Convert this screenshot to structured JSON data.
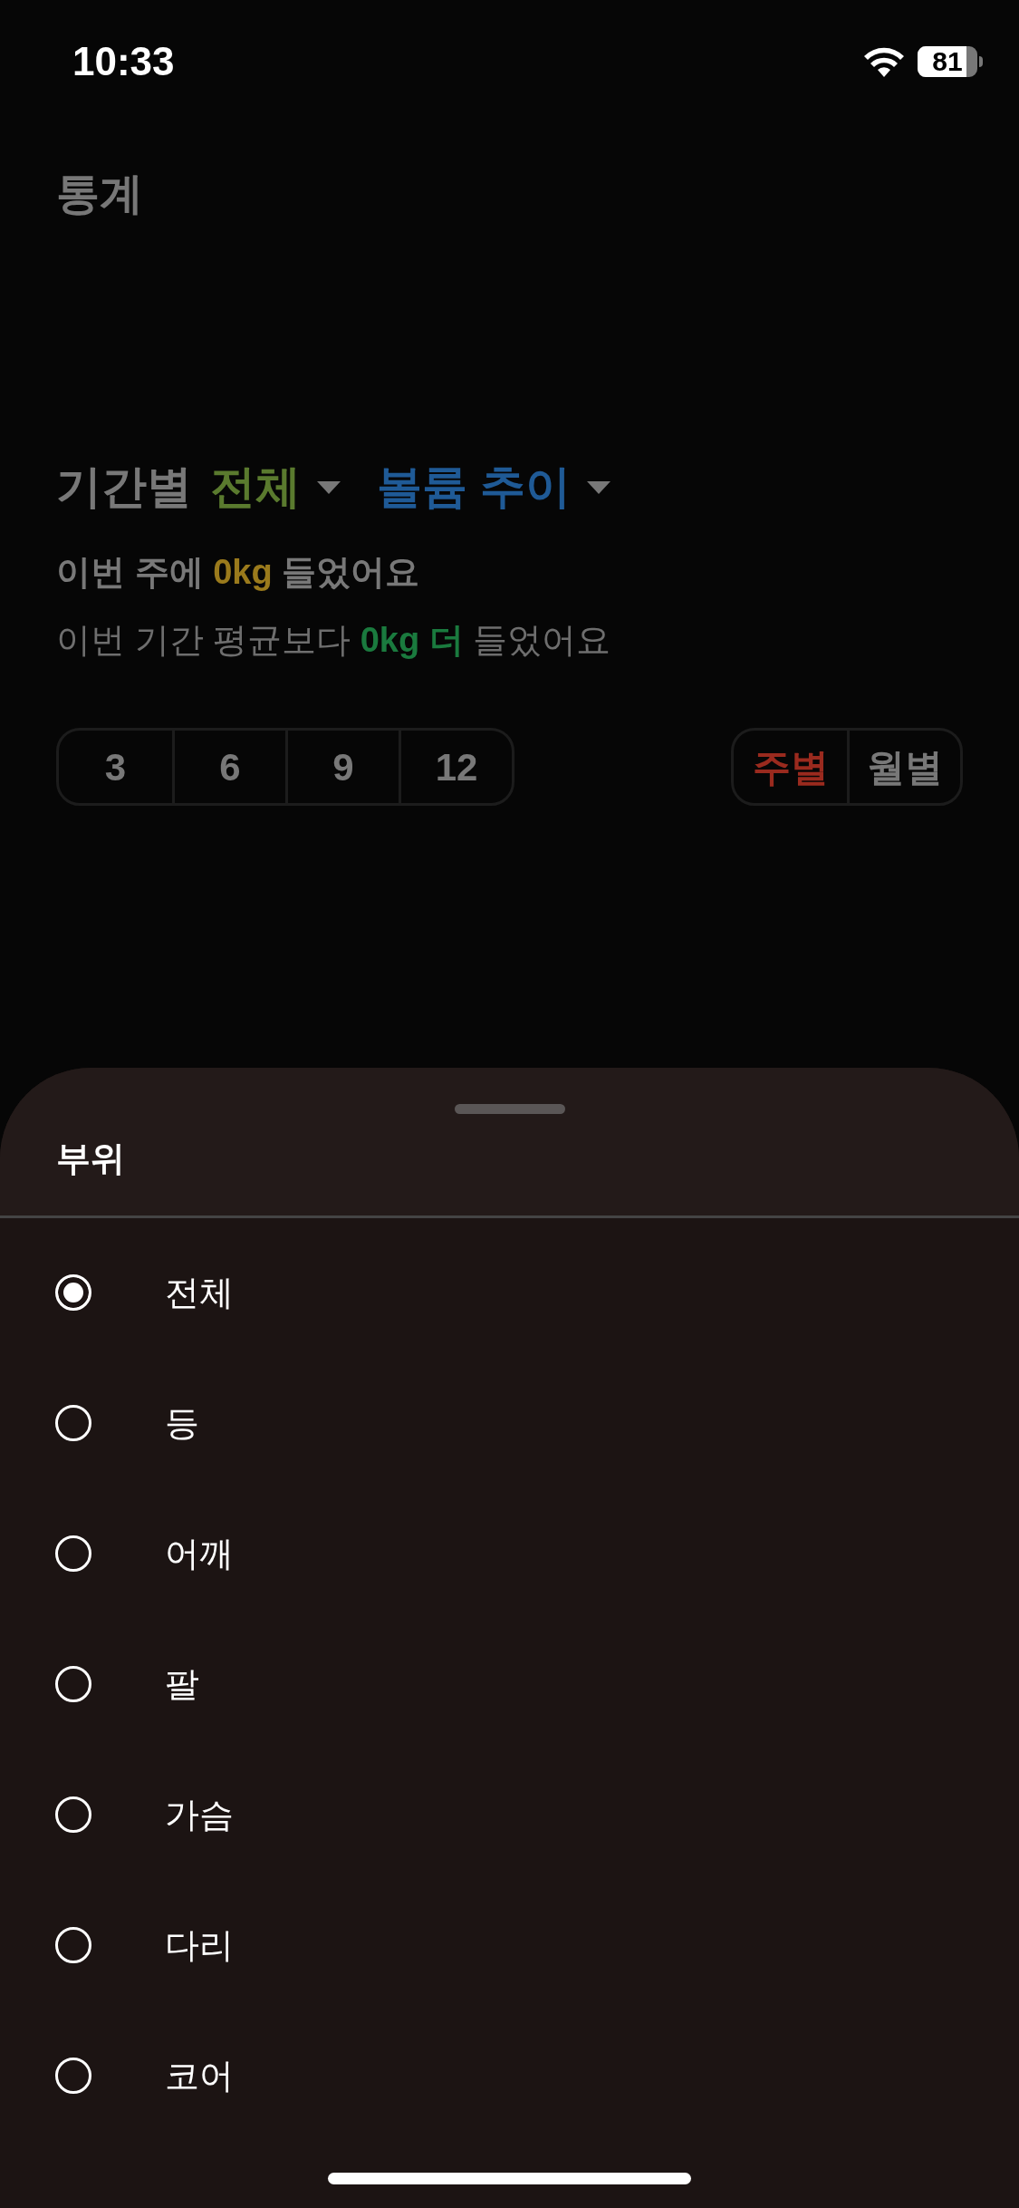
{
  "status_bar": {
    "time": "10:33",
    "battery": "81"
  },
  "header": {
    "title": "통계"
  },
  "filters": {
    "label": "기간별",
    "part": "전체",
    "metric": "볼륨 추이"
  },
  "summary": [
    {
      "kind": "bold",
      "parts": [
        {
          "text": "이번 주에 ",
          "kind": "plain"
        },
        {
          "text": "0kg",
          "kind": "amount"
        },
        {
          "text": " 들었어요",
          "kind": "plain"
        }
      ]
    },
    {
      "kind": "normal",
      "parts": [
        {
          "text": "이번 기간 평균보다 ",
          "kind": "plain"
        },
        {
          "text": "0kg 더",
          "kind": "diff"
        },
        {
          "text": " 들었어요",
          "kind": "plain"
        }
      ]
    }
  ],
  "periods": [
    {
      "label": "3",
      "selected": false
    },
    {
      "label": "6",
      "selected": false
    },
    {
      "label": "9",
      "selected": false
    },
    {
      "label": "12",
      "selected": false
    }
  ],
  "units": [
    {
      "label": "주별",
      "selected": true
    },
    {
      "label": "월별",
      "selected": false
    }
  ],
  "sheet": {
    "title": "부위",
    "options": [
      {
        "label": "전체",
        "selected": true
      },
      {
        "label": "등",
        "selected": false
      },
      {
        "label": "어깨",
        "selected": false
      },
      {
        "label": "팔",
        "selected": false
      },
      {
        "label": "가슴",
        "selected": false
      },
      {
        "label": "다리",
        "selected": false
      },
      {
        "label": "코어",
        "selected": false
      }
    ]
  }
}
